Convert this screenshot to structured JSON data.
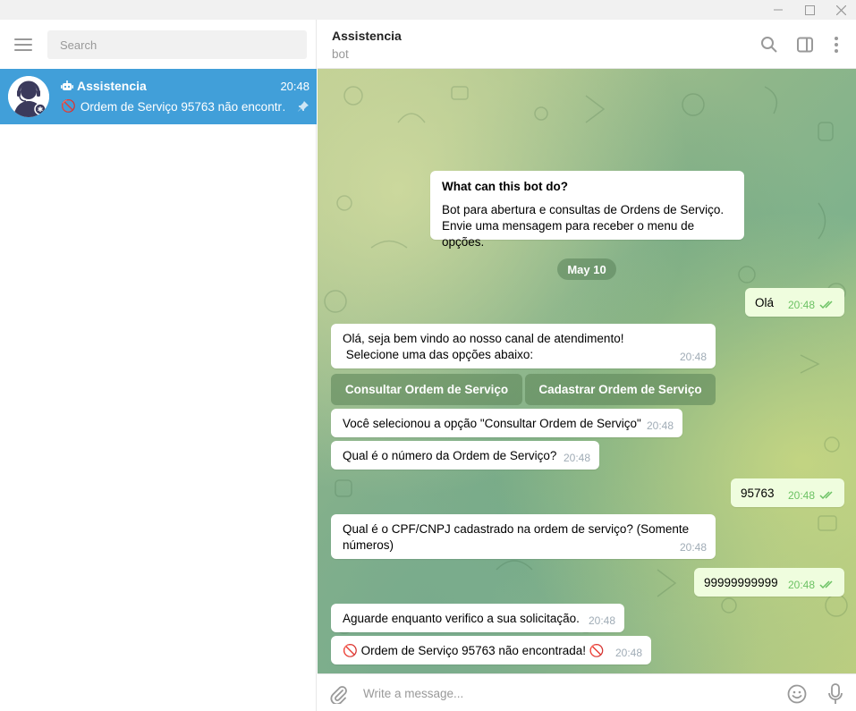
{
  "window": {
    "minimize_glyph": "—",
    "maximize_glyph": "☐",
    "close_glyph": "✕"
  },
  "sidebar": {
    "search_placeholder": "Search",
    "chat": {
      "name": "Assistencia",
      "time": "20:48",
      "preview": "Ordem de Serviço 95763 não encontr…",
      "preview_emoji": "🚫",
      "bot_icon": "bot-icon",
      "pin_icon": "pin-icon"
    }
  },
  "header": {
    "title": "Assistencia",
    "subtitle": "bot"
  },
  "chat": {
    "info": {
      "title": "What can this bot do?",
      "line1": "Bot para abertura e consultas de Ordens de Serviço.",
      "line2": "Envie uma mensagem para receber o menu de opções."
    },
    "date": "May 10",
    "messages": [
      {
        "id": "m1",
        "dir": "out",
        "text": "Olá",
        "time": "20:48"
      },
      {
        "id": "m2",
        "dir": "in",
        "line1": "Olá, seja bem vindo ao nosso canal de atendimento!",
        "line2": " Selecione uma das opções abaixo:",
        "time": "20:48"
      },
      {
        "id": "m3",
        "dir": "in",
        "text": "Você selecionou a opção \"Consultar Ordem de Serviço\"",
        "time": "20:48"
      },
      {
        "id": "m4",
        "dir": "in",
        "text": "Qual é o número da Ordem de Serviço?",
        "time": "20:48"
      },
      {
        "id": "m5",
        "dir": "out",
        "text": "95763",
        "time": "20:48"
      },
      {
        "id": "m6",
        "dir": "in",
        "line1": "Qual é o CPF/CNPJ cadastrado na ordem de serviço? (Somente",
        "line2": "números)",
        "time": "20:48"
      },
      {
        "id": "m7",
        "dir": "out",
        "text": "99999999999",
        "time": "20:48"
      },
      {
        "id": "m8",
        "dir": "in",
        "text": "Aguarde enquanto verifico a sua solicitação.",
        "time": "20:48"
      },
      {
        "id": "m9",
        "dir": "in",
        "text": "Ordem de Serviço 95763 não encontrada!",
        "emoji": "🚫",
        "time": "20:48"
      }
    ],
    "keyboard": {
      "button1": "Consultar Ordem de Serviço",
      "button2": "Cadastrar Ordem de Serviço"
    }
  },
  "composer": {
    "placeholder": "Write a message..."
  },
  "colors": {
    "accent": "#419fd9",
    "outgoing_bubble": "#effdde",
    "read_check": "#6cc264"
  }
}
